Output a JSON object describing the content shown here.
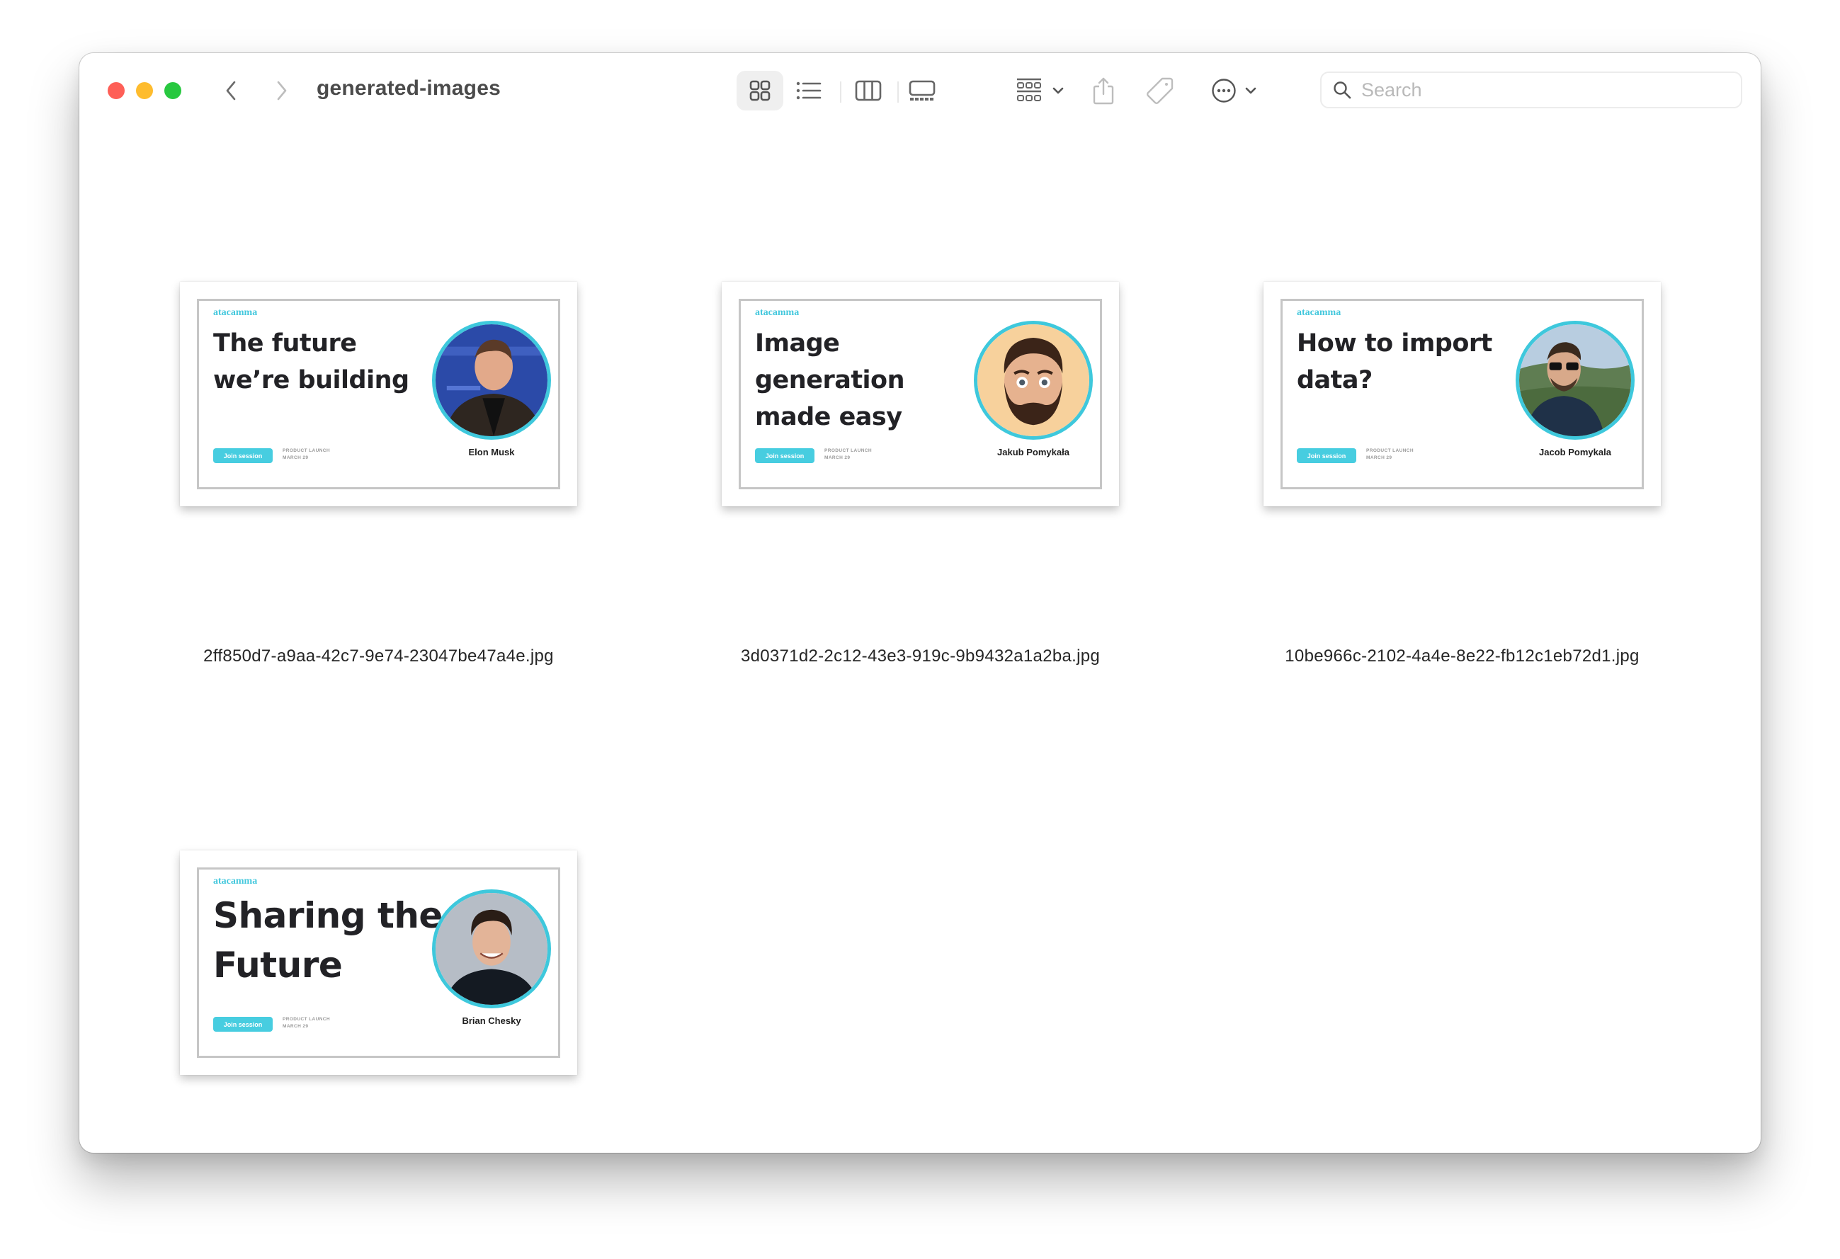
{
  "window": {
    "title": "generated-images",
    "traffic_lights": [
      "close",
      "minimize",
      "zoom"
    ]
  },
  "toolbar": {
    "back_icon": "chevron-left-icon",
    "forward_icon": "chevron-right-icon",
    "view_modes": [
      {
        "name": "icon-view",
        "icon": "grid-icon",
        "selected": true
      },
      {
        "name": "list-view",
        "icon": "list-icon",
        "selected": false
      },
      {
        "name": "column-view",
        "icon": "columns-icon",
        "selected": false
      },
      {
        "name": "gallery-view",
        "icon": "gallery-icon",
        "selected": false
      }
    ],
    "group_icon": "group-by-icon",
    "share_icon": "share-icon",
    "tag_icon": "tag-icon",
    "more_icon": "ellipsis-circle-icon",
    "search": {
      "placeholder": "Search",
      "value": ""
    }
  },
  "accent_color": "#3ec8dc",
  "files": [
    {
      "filename": "2ff850d7-a9aa-42c7-9e74-23047be47a4e.jpg",
      "thumbnail": {
        "brand": "atacamma",
        "headline": "The future we’re building",
        "button": "Join session",
        "meta_line1": "PRODUCT LAUNCH",
        "meta_line2": "MARCH 29",
        "person": "Elon Musk"
      }
    },
    {
      "filename": "3d0371d2-2c12-43e3-919c-9b9432a1a2ba.jpg",
      "thumbnail": {
        "brand": "atacamma",
        "headline": "Image generation made easy",
        "button": "Join session",
        "meta_line1": "PRODUCT LAUNCH",
        "meta_line2": "MARCH 29",
        "person": "Jakub Pomykała"
      }
    },
    {
      "filename": "10be966c-2102-4a4e-8e22-fb12c1eb72d1.jpg",
      "thumbnail": {
        "brand": "atacamma",
        "headline": "How to import data?",
        "button": "Join session",
        "meta_line1": "PRODUCT LAUNCH",
        "meta_line2": "MARCH 29",
        "person": "Jacob Pomykala"
      }
    },
    {
      "filename": "",
      "thumbnail": {
        "brand": "atacamma",
        "headline": "Sharing the Future",
        "button": "Join session",
        "meta_line1": "PRODUCT LAUNCH",
        "meta_line2": "MARCH 29",
        "person": "Brian Chesky"
      }
    }
  ]
}
